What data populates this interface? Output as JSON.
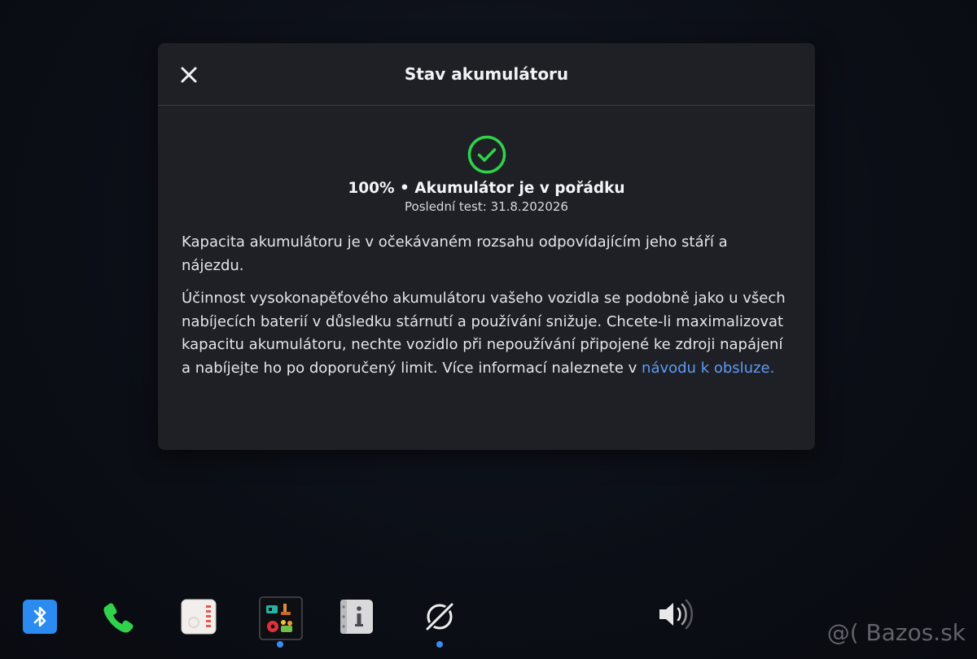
{
  "modal": {
    "title": "Stav akumulátoru",
    "status_line": "100% • Akumulátor je v pořádku",
    "last_test": "Poslední test: 31.8.202026",
    "paragraph1": "Kapacita akumulátoru je v očekávaném rozsahu odpovídajícím jeho stáří a nájezdu.",
    "paragraph2_text": "Účinnost vysokonapěťového akumulátoru vašeho vozidla se podobně jako u všech nabíjecích baterií v důsledku stárnutí a používání snižuje. Chcete-li maximalizovat kapacitu akumulátoru, nechte vozidlo při nepoužívání připojené ke zdroji napájení a nabíjejte ho po doporučený limit. Více informací naleznete v ",
    "paragraph2_link": "návodu k obsluze.",
    "status_color": "#2fd24a",
    "link_color": "#5b9cf6"
  },
  "dock": {
    "items": [
      {
        "icon": "bluetooth-icon",
        "active": false
      },
      {
        "icon": "phone-icon",
        "active": false
      },
      {
        "icon": "calendar-app-icon",
        "active": false
      },
      {
        "icon": "app-launcher-icon",
        "active": true
      },
      {
        "icon": "manual-info-icon",
        "active": false
      },
      {
        "icon": "disconnected-icon",
        "active": true
      },
      {
        "icon": "volume-icon",
        "active": false
      }
    ],
    "active_indicator_color": "#3b8cf2"
  },
  "watermark": "@( Bazos.sk"
}
